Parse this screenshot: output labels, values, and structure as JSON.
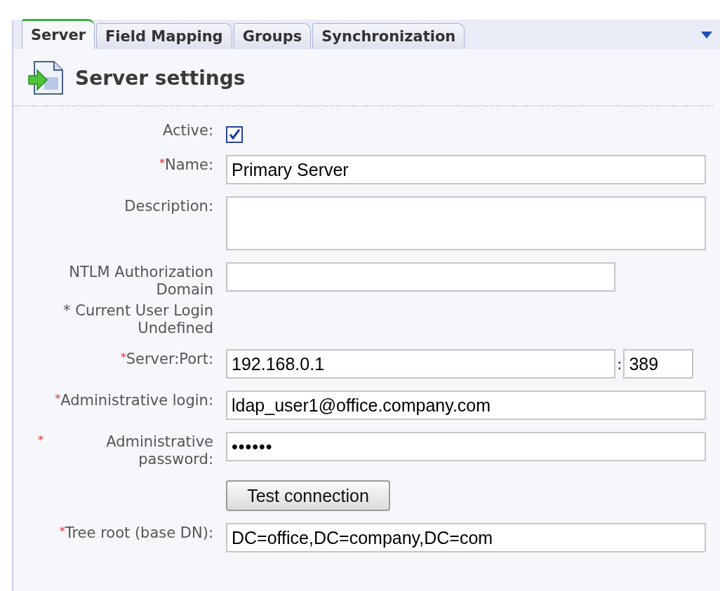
{
  "tabs": [
    {
      "label": "Server",
      "selected": true
    },
    {
      "label": "Field Mapping",
      "selected": false
    },
    {
      "label": "Groups",
      "selected": false
    },
    {
      "label": "Synchronization",
      "selected": false
    }
  ],
  "section": {
    "title": "Server settings"
  },
  "required_sign": "*",
  "fields": [
    {
      "kind": "checkbox",
      "label": "Active:",
      "checked": true
    },
    {
      "kind": "text",
      "label": "Name:",
      "required": true,
      "value": "Primary Server"
    },
    {
      "kind": "textarea",
      "label": "Description:"
    },
    {
      "kind": "short",
      "label": "NTLM Authorization Domain",
      "note": "* Current User Login Undefined"
    },
    {
      "kind": "serverport",
      "label": "Server:Port:",
      "required": true,
      "value": "192.168.0.1",
      "separator": ":",
      "port": "389"
    },
    {
      "kind": "text",
      "label": "Administrative login:",
      "required": true,
      "value": "ldap_user1@office.company.com"
    },
    {
      "kind": "password",
      "label": "Administrative password:",
      "required": true,
      "value": "••••••"
    },
    {
      "kind": "button",
      "label": "Test connection"
    },
    {
      "kind": "text",
      "label": "Tree root (base DN):",
      "required": true,
      "value": "DC=office,DC=company,DC=com"
    }
  ]
}
